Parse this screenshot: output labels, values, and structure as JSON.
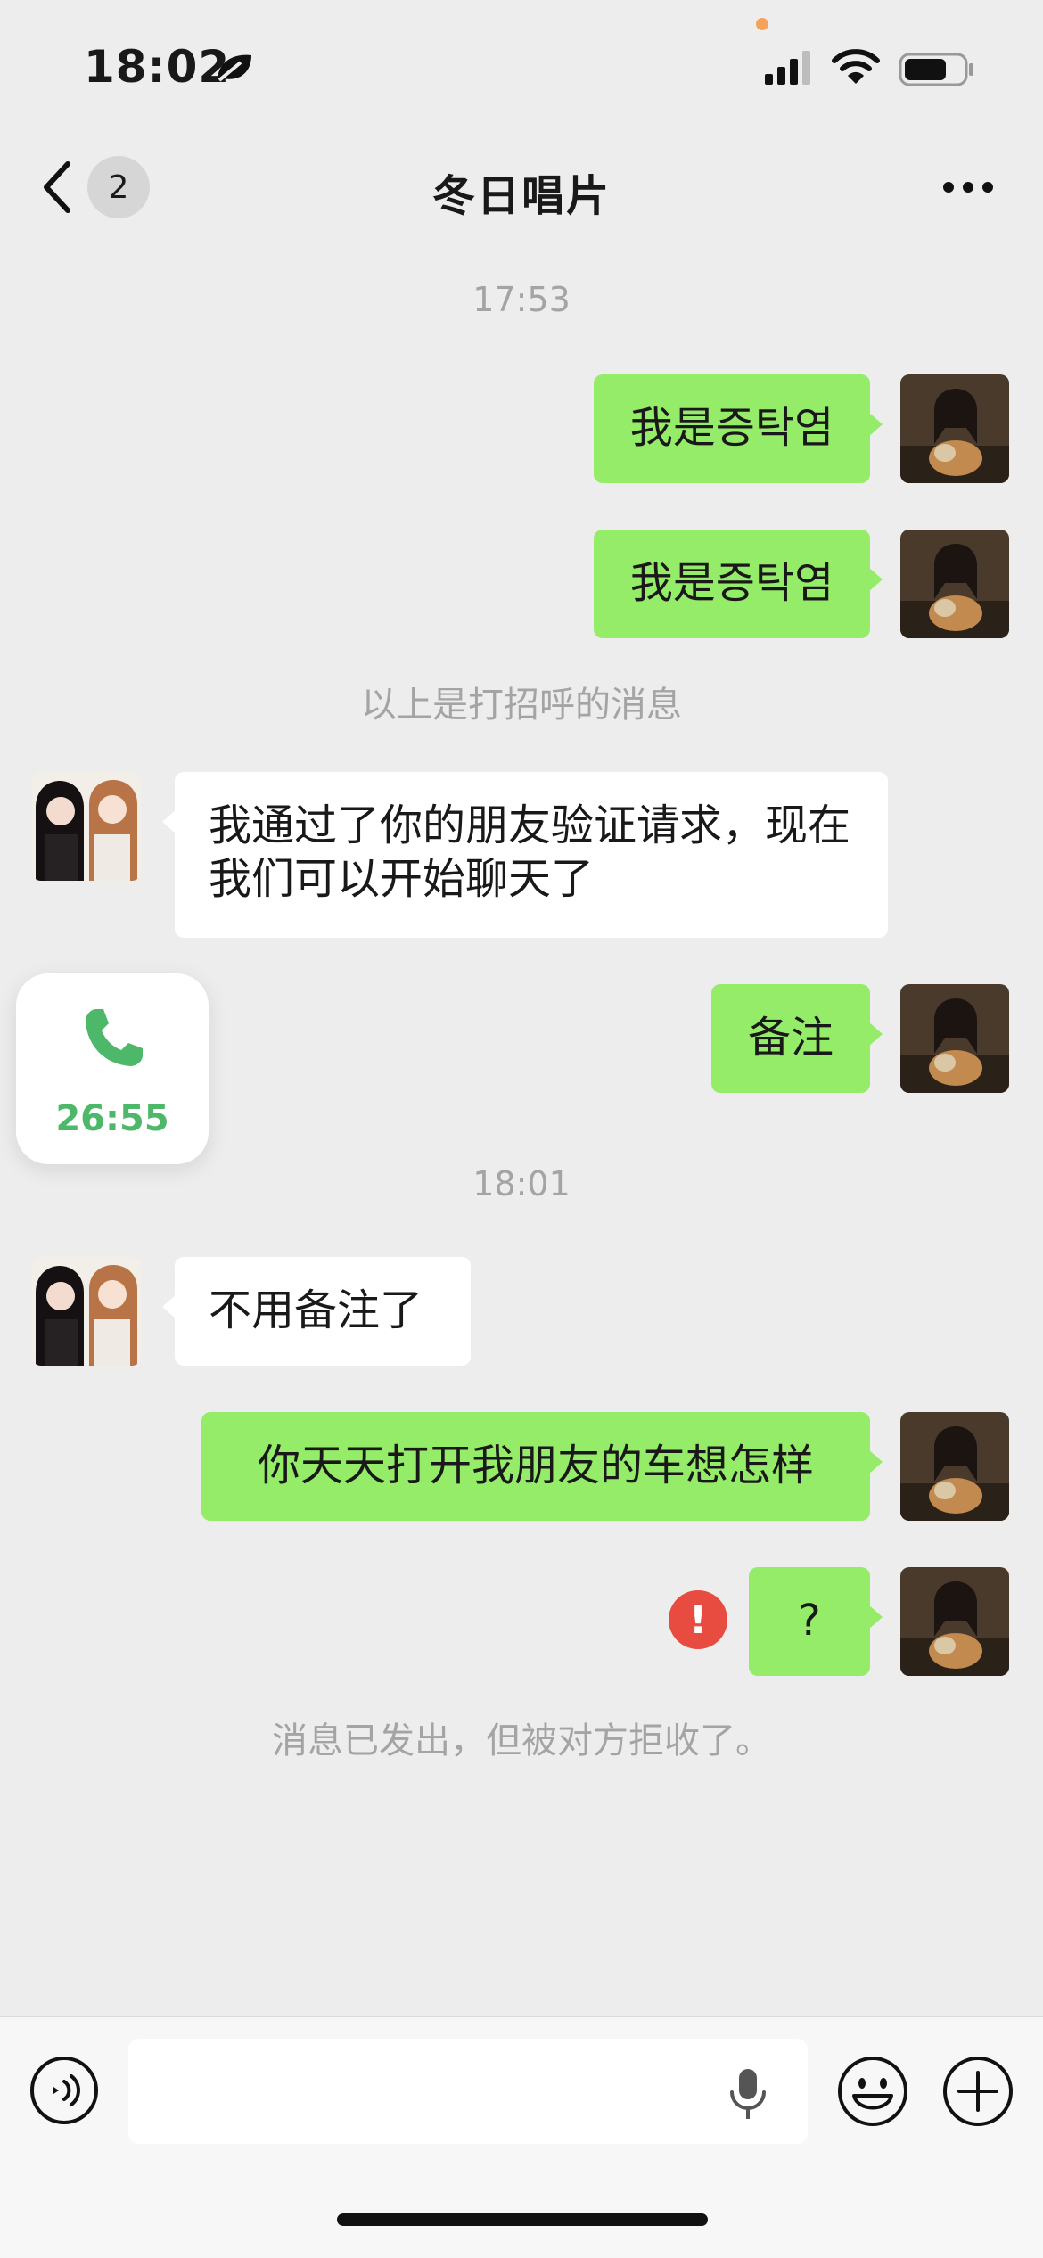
{
  "status_bar": {
    "time": "18:02"
  },
  "nav": {
    "unread_count": "2",
    "title": "冬日唱片"
  },
  "timestamps": [
    "17:53",
    "18:01"
  ],
  "messages": [
    {
      "side": "me",
      "text": "我是증탁염"
    },
    {
      "side": "me",
      "text": "我是증탁염"
    },
    {
      "side": "them",
      "text": "我通过了你的朋友验证请求，现在我们可以开始聊天了"
    },
    {
      "side": "me",
      "text": "备注"
    },
    {
      "side": "them",
      "text": "不用备注了"
    },
    {
      "side": "me",
      "text": "你天天打开我朋友的车想怎样"
    },
    {
      "side": "me",
      "text": "?"
    }
  ],
  "system": {
    "greeting_note": "以上是打招呼的消息",
    "rejected_note": "消息已发出，但被对方拒收了。"
  },
  "call_card": {
    "duration": "26:55",
    "icon": "phone-icon",
    "color": "#4EB86A"
  },
  "error_mark": "!",
  "colors": {
    "my_bubble": "#95EC69",
    "their_bubble": "#FFFFFF",
    "background": "#EDEDED",
    "error": "#E84B3F"
  }
}
